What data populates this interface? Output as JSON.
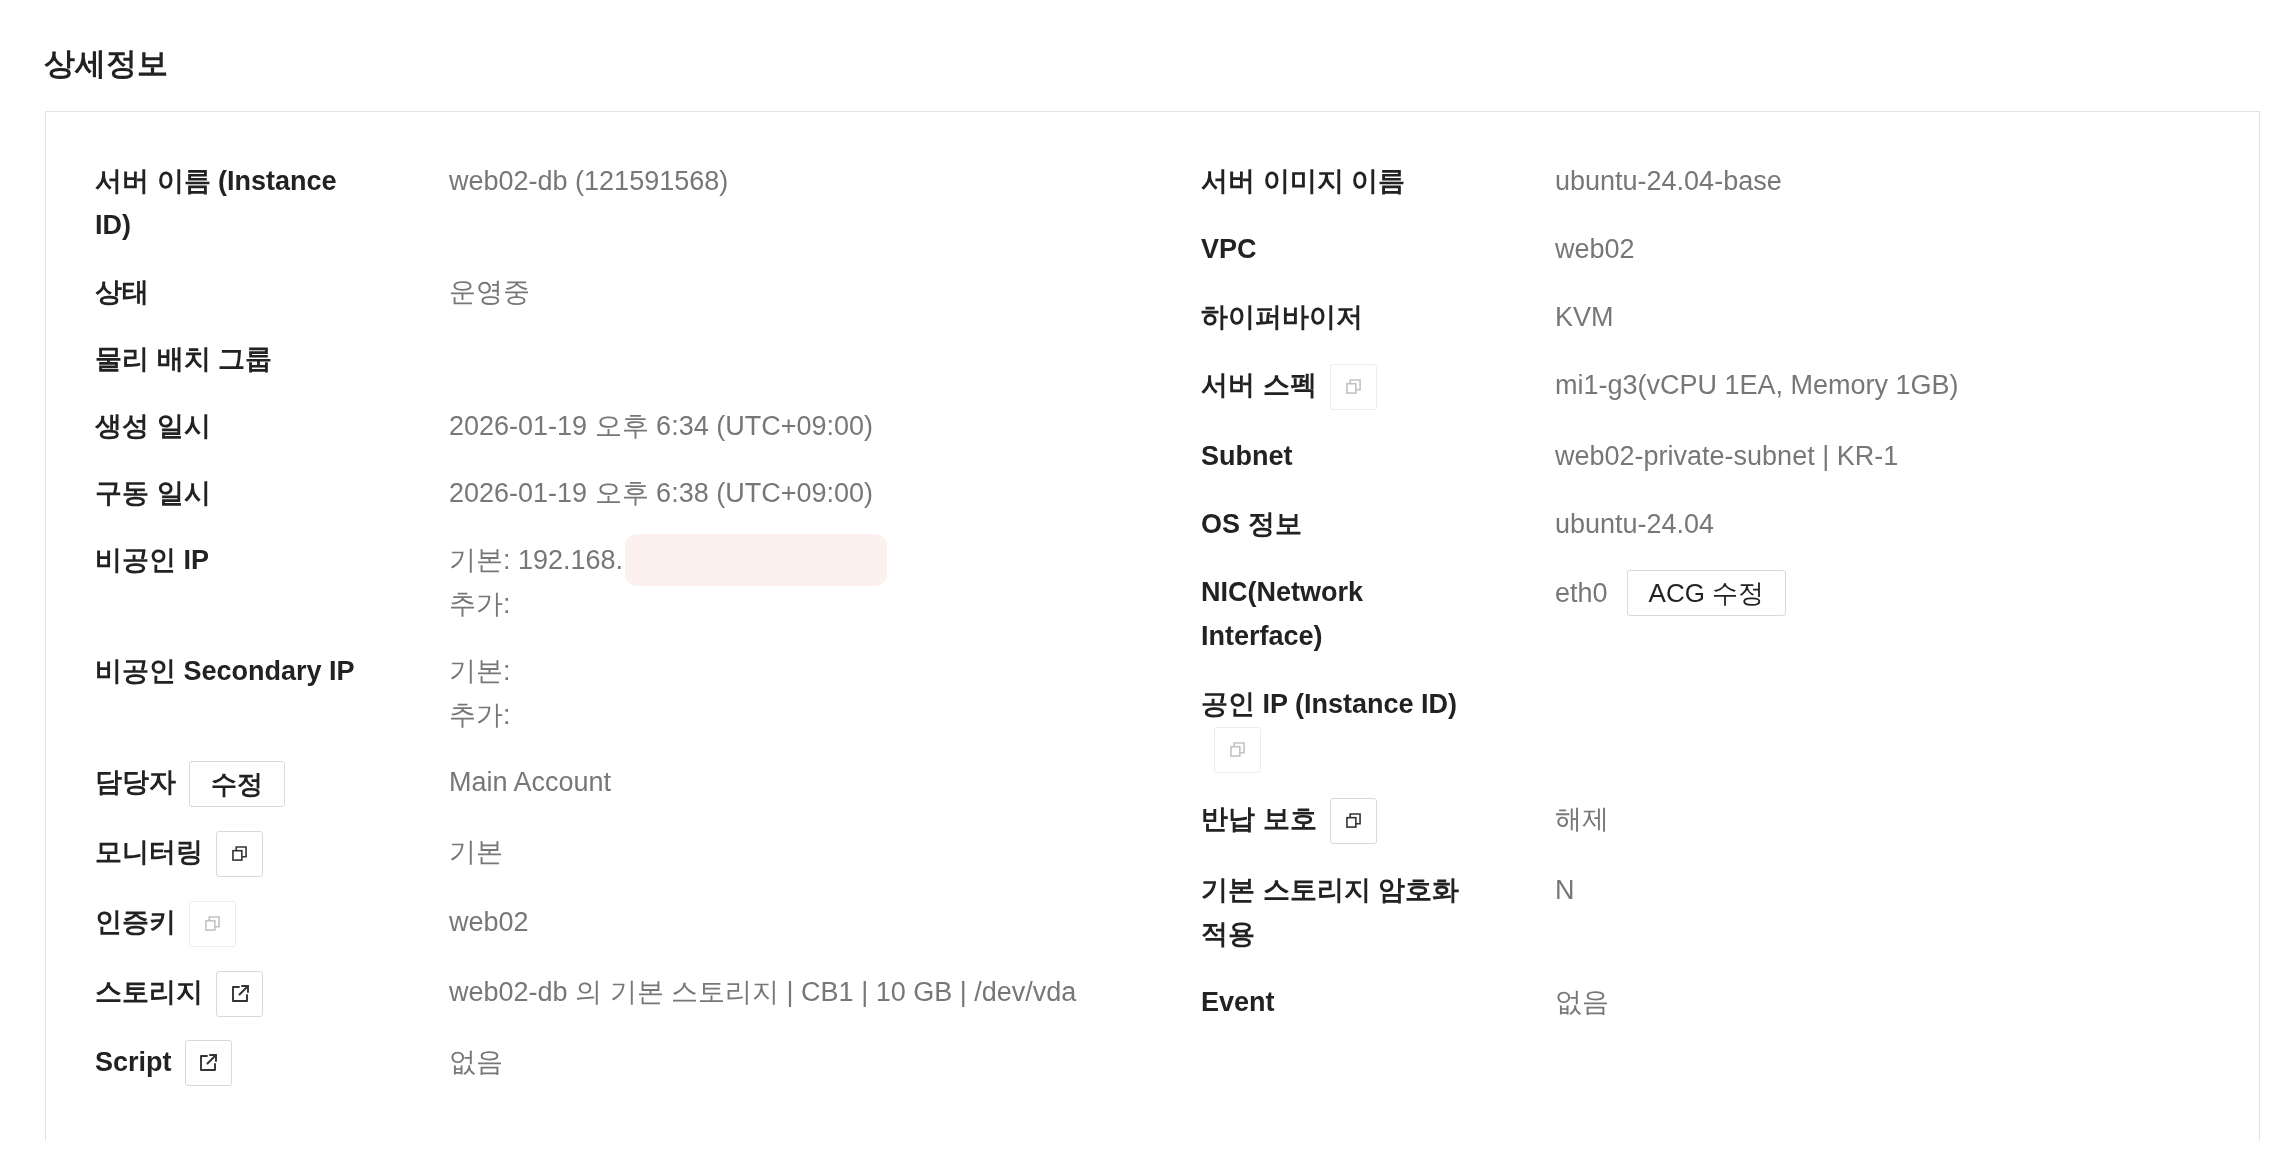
{
  "section": {
    "title": "상세정보"
  },
  "left_fields": [
    {
      "label": "서버 이름 (Instance ID)",
      "value": "web02-db (121591568)"
    },
    {
      "label": "상태",
      "value": "운영중"
    },
    {
      "label": "물리 배치 그룹"
    },
    {
      "label": "생성 일시",
      "value": "2026-01-19 오후 6:34 (UTC+09:00)"
    },
    {
      "label": "구동 일시",
      "value": "2026-01-19 오후 6:38 (UTC+09:00)"
    },
    {
      "label": "비공인 IP",
      "lines": [
        {
          "text": "기본: 192.168.",
          "masked": true
        },
        {
          "text": "추가:",
          "masked": false
        }
      ]
    },
    {
      "label": "비공인 Secondary IP",
      "lines": [
        {
          "text": "기본:",
          "masked": false
        },
        {
          "text": "추가:",
          "masked": false
        }
      ]
    },
    {
      "label": "담당자",
      "label_action": {
        "kind": "text",
        "text": "수정"
      },
      "value": "Main Account"
    },
    {
      "label": "모니터링",
      "label_action": {
        "kind": "copy",
        "disabled": false
      },
      "value": "기본"
    },
    {
      "label": "인증키",
      "label_action": {
        "kind": "copy",
        "disabled": true
      },
      "value": "web02"
    },
    {
      "label": "스토리지",
      "label_action": {
        "kind": "external",
        "disabled": false
      },
      "value": "web02-db 의 기본 스토리지 | CB1 | 10 GB | /dev/vda"
    },
    {
      "label": "Script",
      "label_action": {
        "kind": "external",
        "disabled": false
      },
      "value": "없음"
    }
  ],
  "right_fields": [
    {
      "label": "서버 이미지 이름",
      "value": "ubuntu-24.04-base"
    },
    {
      "label": "VPC",
      "value": "web02"
    },
    {
      "label": "하이퍼바이저",
      "value": "KVM"
    },
    {
      "label": "서버 스펙",
      "label_action": {
        "kind": "copy",
        "disabled": true
      },
      "value": "mi1-g3(vCPU 1EA, Memory 1GB)"
    },
    {
      "label": "Subnet",
      "value": "web02-private-subnet | KR-1"
    },
    {
      "label": "OS 정보",
      "value": "ubuntu-24.04"
    },
    {
      "label": "NIC(Network Interface)",
      "value": "eth0",
      "value_action": {
        "kind": "text",
        "text": "ACG 수정"
      }
    },
    {
      "label": "공인 IP (Instance ID)",
      "label_action": {
        "kind": "copy",
        "disabled": true
      }
    },
    {
      "label": "반납 보호",
      "label_action": {
        "kind": "copy",
        "disabled": false
      },
      "value": "해제"
    },
    {
      "label": "기본 스토리지 암호화 적용",
      "value": "N"
    },
    {
      "label": "Event",
      "value": "없음"
    }
  ]
}
